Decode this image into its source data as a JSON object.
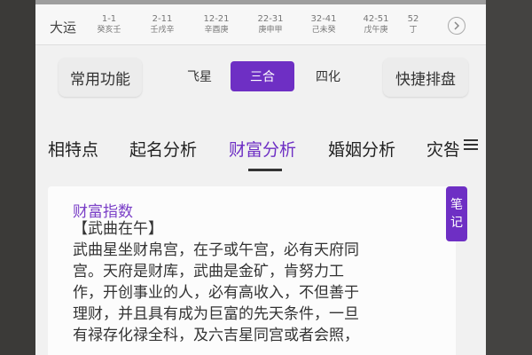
{
  "dayun": {
    "label": "大运",
    "cells": [
      {
        "age": "1-1",
        "ganzhi": "癸亥壬"
      },
      {
        "age": "2-11",
        "ganzhi": "壬戌辛"
      },
      {
        "age": "12-21",
        "ganzhi": "辛酉庚"
      },
      {
        "age": "22-31",
        "ganzhi": "庚申甲"
      },
      {
        "age": "32-41",
        "ganzhi": "己未癸"
      },
      {
        "age": "42-51",
        "ganzhi": "戊午庚"
      },
      {
        "age": "52",
        "ganzhi": "丁"
      }
    ],
    "next_icon": "chevron-right-circle-icon"
  },
  "toolbar": {
    "common_label": "常用功能",
    "quick_label": "快捷排盘",
    "segments": [
      "飞星",
      "三合",
      "四化"
    ],
    "active_segment": "三合"
  },
  "tabs": {
    "items": [
      "相特点",
      "起名分析",
      "财富分析",
      "婚姻分析",
      "灾咎"
    ],
    "active": "财富分析",
    "menu_icon": "hamburger-menu-icon"
  },
  "content": {
    "title": "财富指数",
    "subtitle": "【武曲在午】",
    "lines": [
      "武曲星坐财帛宫，在子或午宫，必有天府同",
      "宫。天府是财库，武曲是金矿，肯努力工",
      "作，开创事业的人，必有高收入，不但善于",
      "理财，并且具有成为巨富的先天条件，一旦",
      "有禄存化禄全科，及六吉星同宫或者会照，"
    ]
  },
  "note_button": {
    "line1": "笔",
    "line2": "记"
  },
  "colors": {
    "accent": "#6e2fc4",
    "title": "#7a3fc7"
  }
}
